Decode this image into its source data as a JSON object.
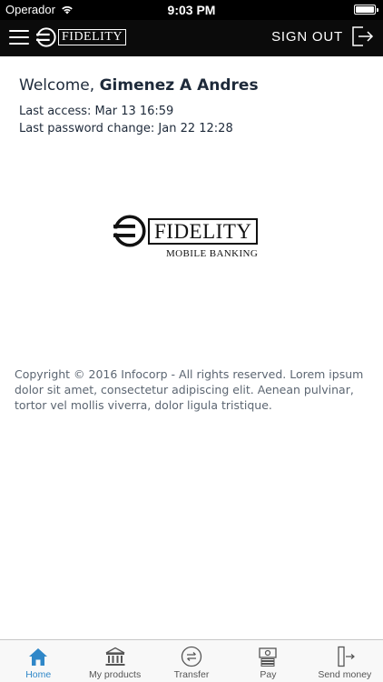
{
  "status_bar": {
    "carrier": "Operador",
    "time": "9:03 PM"
  },
  "header": {
    "logo_text": "FIDELITY",
    "signout_label": "SIGN OUT"
  },
  "welcome": {
    "greeting": "Welcome,",
    "user_name": "Gimenez A Andres",
    "last_access": "Last access: Mar 13 16:59",
    "last_password_change": "Last password change: Jan 22 12:28"
  },
  "brand": {
    "logo_text": "FIDELITY",
    "subtitle": "MOBILE BANKING"
  },
  "footer": {
    "copyright": "Copyright © 2016 Infocorp - All rights reserved. Lorem ipsum dolor sit amet, consectetur adipiscing elit. Aenean pulvinar, tortor vel mollis viverra, dolor ligula tristique."
  },
  "tabbar": {
    "active_color": "#2f87c8",
    "items": [
      {
        "label": "Home",
        "icon": "home-icon"
      },
      {
        "label": "My products",
        "icon": "bank-icon"
      },
      {
        "label": "Transfer",
        "icon": "transfer-icon"
      },
      {
        "label": "Pay",
        "icon": "pay-icon"
      },
      {
        "label": "Send money",
        "icon": "send-money-icon"
      }
    ]
  }
}
